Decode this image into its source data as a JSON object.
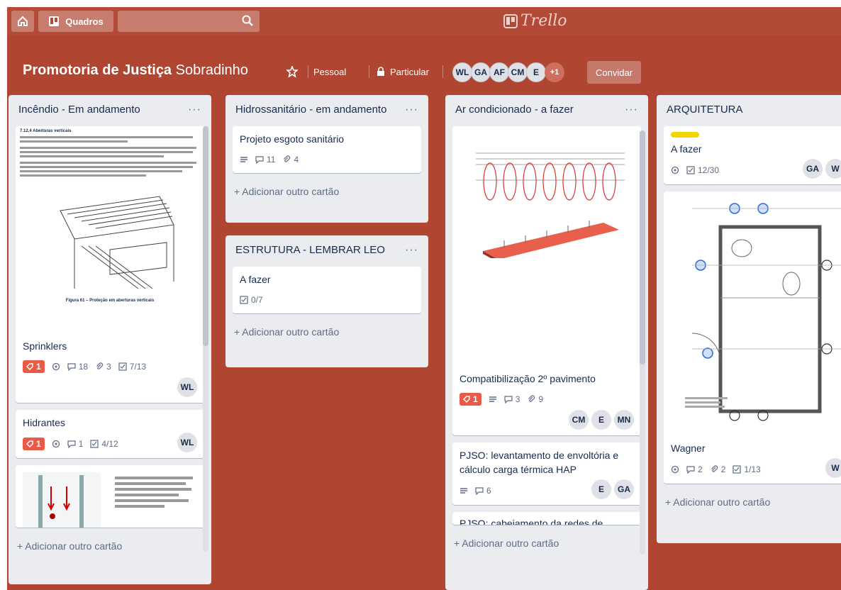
{
  "nav": {
    "boards_label": "Quadros",
    "logo_text": "Trello"
  },
  "board": {
    "title_bold": "Promotoria de Justiça",
    "title_rest": " Sobradinho",
    "visibility_team": "Pessoal",
    "visibility_private": "Particular",
    "members": [
      "WL",
      "GA",
      "AF",
      "CM",
      "E"
    ],
    "members_more": "+1",
    "invite_label": "Convidar"
  },
  "colors": {
    "board_bg": "#b04632",
    "label_red": "#eb5a46",
    "label_yellow": "#f2d600"
  },
  "lists": [
    {
      "title": "Incêndio - Em andamento",
      "cards": [
        {
          "title": "Sprinklers",
          "label_count": "1",
          "comments": "18",
          "attachments": "3",
          "checklist": "7/13",
          "members": [
            "WL"
          ]
        },
        {
          "title": "Hidrantes",
          "label_count": "1",
          "comments": "1",
          "checklist": "4/12",
          "members": [
            "WL"
          ]
        }
      ],
      "doc_heading": "7.12.4 Aberturas verticais",
      "doc_caption": "Figura 61 – Proteção em aberturas verticais",
      "add_label": "+ Adicionar outro cartão"
    },
    {
      "title": "Hidrossanitário - em andamento",
      "cards": [
        {
          "title": "Projeto esgoto sanitário",
          "comments": "11",
          "attachments": "4"
        }
      ],
      "add_label": "+ Adicionar outro cartão"
    },
    {
      "title": "ESTRUTURA - LEMBRAR LEO",
      "cards": [
        {
          "title": "A fazer",
          "checklist": "0/7"
        }
      ],
      "add_label": "+ Adicionar outro cartão"
    },
    {
      "title": "Ar condicionado - a fazer",
      "cards": [
        {
          "title": "Compatibilização 2º pavimento",
          "label_count": "1",
          "comments": "3",
          "attachments": "9",
          "members": [
            "CM",
            "E",
            "MN"
          ]
        },
        {
          "title": "PJSO: levantamento de envoltória e cálculo carga térmica HAP",
          "comments": "6",
          "members": [
            "E",
            "GA"
          ]
        },
        {
          "title": "PJSO: cabeiamento da redes de ..."
        }
      ],
      "add_label": "+ Adicionar outro cartão"
    },
    {
      "title": "ARQUITETURA",
      "cards": [
        {
          "title": "A fazer",
          "checklist": "12/30",
          "members": [
            "GA",
            "W"
          ]
        },
        {
          "title": "Wagner",
          "comments": "2",
          "attachments": "2",
          "checklist": "1/13",
          "members": [
            "W"
          ]
        }
      ],
      "add_label": "+ Adicionar outro cartão"
    }
  ]
}
